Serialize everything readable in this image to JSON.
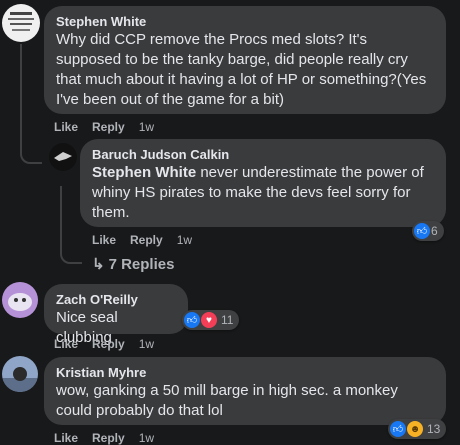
{
  "comments": [
    {
      "author": "Stephen White",
      "text": "Why did CCP remove the Procs med slots? It's supposed to be the tanky barge, did people really cry that much about it having a lot of HP or something?(Yes I've been out of the game for a bit)",
      "like": "Like",
      "reply": "Reply",
      "time": "1w"
    },
    {
      "author": "Baruch Judson Calkin",
      "mention": "Stephen White",
      "text": " never underestimate the power of whiny HS pirates to make the devs feel sorry for them.",
      "like": "Like",
      "reply": "Reply",
      "time": "1w",
      "reaction_count": "6"
    },
    {
      "author": "Zach O'Reilly",
      "text": "Nice seal clubbing",
      "like": "Like",
      "reply": "Reply",
      "time": "1w",
      "reaction_count": "11"
    },
    {
      "author": "Kristian Myhre",
      "text": "wow, ganking a 50 mill barge in high sec. a monkey could probably do that lol",
      "like": "Like",
      "reply": "Reply",
      "time": "1w",
      "reaction_count": "13"
    }
  ],
  "replies_link": "7 Replies",
  "colors": {
    "background": "#18191a",
    "bubble": "#3a3b3c",
    "like": "#1877f2",
    "love": "#f33e58"
  }
}
